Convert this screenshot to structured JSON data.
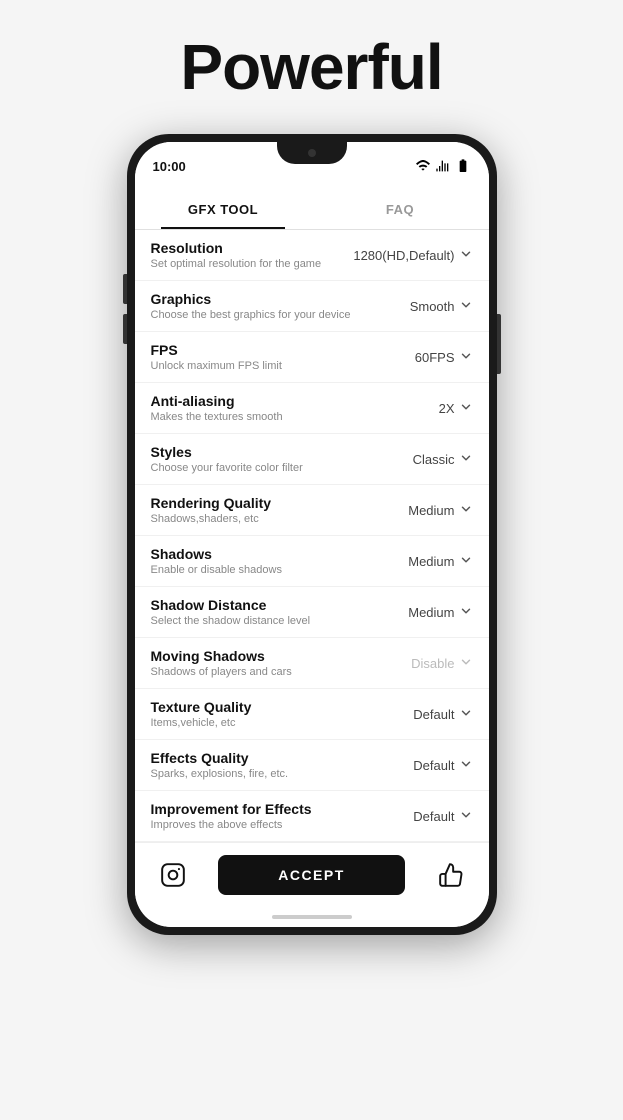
{
  "hero": {
    "title": "Powerful"
  },
  "phone": {
    "status": {
      "time": "10:00"
    },
    "tabs": [
      {
        "id": "gfx",
        "label": "GFX TOOL",
        "active": true
      },
      {
        "id": "faq",
        "label": "FAQ",
        "active": false
      }
    ],
    "settings": [
      {
        "id": "resolution",
        "title": "Resolution",
        "desc": "Set optimal resolution for the game",
        "value": "1280(HD,Default)",
        "disabled": false
      },
      {
        "id": "graphics",
        "title": "Graphics",
        "desc": "Choose the best graphics for your device",
        "value": "Smooth",
        "disabled": false
      },
      {
        "id": "fps",
        "title": "FPS",
        "desc": "Unlock maximum FPS limit",
        "value": "60FPS",
        "disabled": false
      },
      {
        "id": "anti-aliasing",
        "title": "Anti-aliasing",
        "desc": "Makes the textures smooth",
        "value": "2X",
        "disabled": false
      },
      {
        "id": "styles",
        "title": "Styles",
        "desc": "Choose your favorite color filter",
        "value": "Classic",
        "disabled": false
      },
      {
        "id": "rendering-quality",
        "title": "Rendering Quality",
        "desc": "Shadows,shaders, etc",
        "value": "Medium",
        "disabled": false
      },
      {
        "id": "shadows",
        "title": "Shadows",
        "desc": "Enable or disable shadows",
        "value": "Medium",
        "disabled": false
      },
      {
        "id": "shadow-distance",
        "title": "Shadow Distance",
        "desc": "Select the shadow distance level",
        "value": "Medium",
        "disabled": false
      },
      {
        "id": "moving-shadows",
        "title": "Moving Shadows",
        "desc": "Shadows of players and cars",
        "value": "Disable",
        "disabled": true
      },
      {
        "id": "texture-quality",
        "title": "Texture Quality",
        "desc": "Items,vehicle, etc",
        "value": "Default",
        "disabled": false
      },
      {
        "id": "effects-quality",
        "title": "Effects Quality",
        "desc": "Sparks, explosions, fire, etc.",
        "value": "Default",
        "disabled": false
      },
      {
        "id": "improvement-effects",
        "title": "Improvement for Effects",
        "desc": "Improves the above effects",
        "value": "Default",
        "disabled": false
      }
    ],
    "bottom_bar": {
      "accept_label": "ACCEPT"
    }
  }
}
